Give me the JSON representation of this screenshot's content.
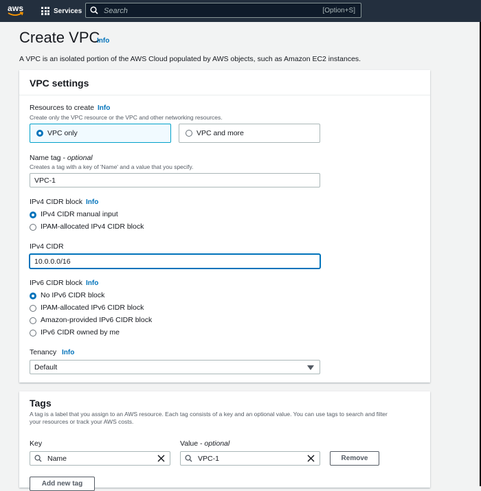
{
  "nav": {
    "logo_text": "aws",
    "services_label": "Services",
    "search_placeholder": "Search",
    "search_shortcut": "[Option+S]"
  },
  "page": {
    "title": "Create VPC",
    "title_info": "Info",
    "description": "A VPC is an isolated portion of the AWS Cloud populated by AWS objects, such as Amazon EC2 instances."
  },
  "vpc_settings": {
    "header": "VPC settings",
    "resources": {
      "label": "Resources to create",
      "info": "Info",
      "description": "Create only the VPC resource or the VPC and other networking resources.",
      "options": [
        {
          "label": "VPC only",
          "selected": true
        },
        {
          "label": "VPC and more",
          "selected": false
        }
      ]
    },
    "name_tag": {
      "label": "Name tag - ",
      "label_optional": "optional",
      "description": "Creates a tag with a key of 'Name' and a value that you specify.",
      "value": "VPC-1"
    },
    "ipv4_block": {
      "label": "IPv4 CIDR block",
      "info": "Info",
      "options": [
        {
          "label": "IPv4 CIDR manual input",
          "selected": true
        },
        {
          "label": "IPAM-allocated IPv4 CIDR block",
          "selected": false
        }
      ]
    },
    "ipv4_cidr": {
      "label": "IPv4 CIDR",
      "value": "10.0.0.0/16"
    },
    "ipv6_block": {
      "label": "IPv6 CIDR block",
      "info": "Info",
      "options": [
        {
          "label": "No IPv6 CIDR block",
          "selected": true
        },
        {
          "label": "IPAM-allocated IPv6 CIDR block",
          "selected": false
        },
        {
          "label": "Amazon-provided IPv6 CIDR block",
          "selected": false
        },
        {
          "label": "IPv6 CIDR owned by me",
          "selected": false
        }
      ]
    },
    "tenancy": {
      "label": "Tenancy",
      "info": "Info",
      "value": "Default"
    }
  },
  "tags": {
    "header": "Tags",
    "description_line1": "A tag is a label that you assign to an AWS resource. Each tag consists of a key and an optional value. You can use tags to search and filter",
    "description_line2": "your resources or track your AWS costs.",
    "key_label": "Key",
    "value_label": "Value - ",
    "value_label_optional": "optional",
    "rows": [
      {
        "key": "Name",
        "value": "VPC-1"
      }
    ],
    "remove_label": "Remove",
    "add_label": "Add new tag"
  },
  "colors": {
    "nav_bg": "#232f3e",
    "link": "#0073bb",
    "selected_border": "#00a1c9",
    "selected_bg": "#f1faff"
  }
}
